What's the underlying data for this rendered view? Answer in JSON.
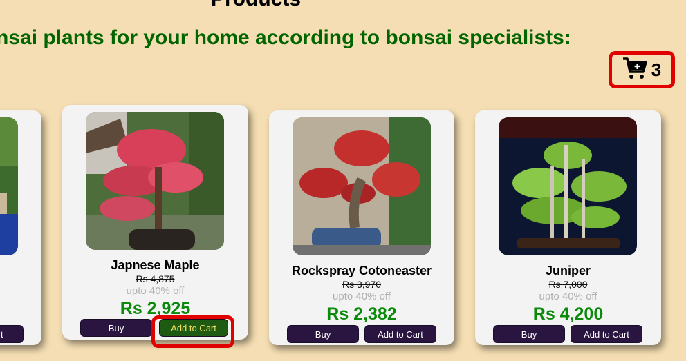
{
  "page": {
    "section_title": "Products",
    "headline": "nsai plants for your home according to bonsai specialists:"
  },
  "cart": {
    "icon": "cart-plus-icon",
    "count": "3"
  },
  "products": [
    {
      "name": "",
      "old_price": "",
      "discount": "",
      "price": "",
      "buy_label": "",
      "add_label": "art"
    },
    {
      "name": "Japnese Maple",
      "old_price": "Rs 4,875",
      "discount": "upto 40% off",
      "price": "Rs 2,925",
      "buy_label": "Buy",
      "add_label": "Add to Cart"
    },
    {
      "name": "Rockspray Cotoneaster",
      "old_price": "Rs 3,970",
      "discount": "upto 40% off",
      "price": "Rs 2,382",
      "buy_label": "Buy",
      "add_label": "Add to Cart"
    },
    {
      "name": "Juniper",
      "old_price": "Rs 7,000",
      "discount": "upto 40% off",
      "price": "Rs 4,200",
      "buy_label": "Buy",
      "add_label": "Add to Cart"
    }
  ],
  "colors": {
    "background": "#f5deb3",
    "headline": "#006400",
    "price": "#0a8a0a",
    "button": "#2a1540",
    "highlight": "#e00000"
  }
}
